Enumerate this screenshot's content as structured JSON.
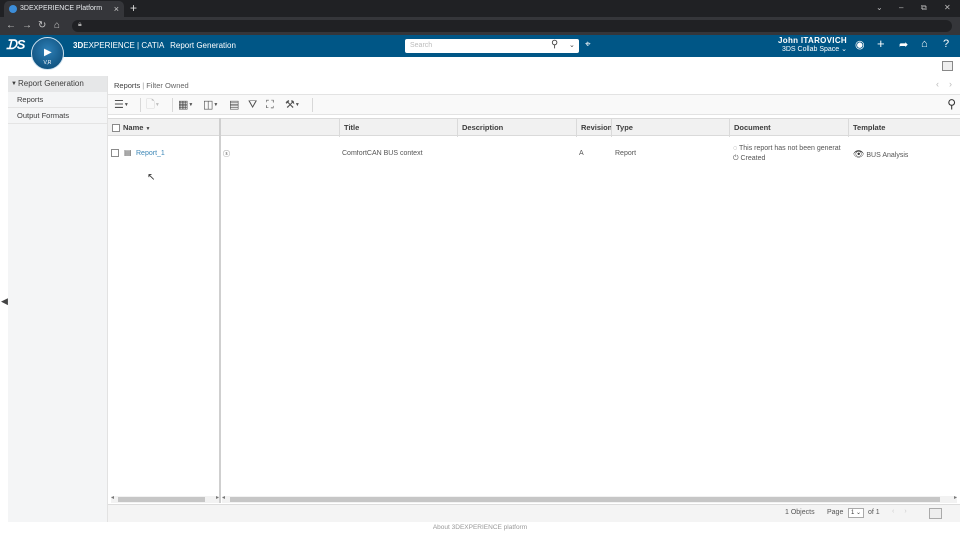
{
  "browser": {
    "tab_title": "3DEXPERIENCE Platform",
    "tab_close": "×",
    "new_tab": "+",
    "controls": {
      "chevron": "⌄",
      "minimize": "–",
      "restore": "⧉",
      "close": "✕"
    },
    "nav": {
      "back": "←",
      "forward": "→",
      "reload": "↻",
      "home": "⌂"
    }
  },
  "app": {
    "brand_prefix": "3D",
    "brand_rest": "EXPERIENCE | CATIA",
    "app_name": "Report Generation",
    "compass_label": "V,R",
    "search_placeholder": "Search",
    "user_name": "John  ITAROVICH",
    "collab_space": "3DS Collab Space ⌄"
  },
  "sidebar": {
    "header": "Report Generation",
    "items": [
      {
        "label": "Reports"
      },
      {
        "label": "Output Formats"
      }
    ]
  },
  "main": {
    "breadcrumb": "Reports",
    "filter": "Filter Owned",
    "columns": {
      "name": "Name",
      "title": "Title",
      "description": "Description",
      "revision": "Revision",
      "type": "Type",
      "document": "Document",
      "template": "Template"
    },
    "rows": [
      {
        "name": "Report_1",
        "title": "ComfortCAN BUS context",
        "description": "",
        "revision": "A",
        "type": "Report",
        "document_status": "This report has not been generat",
        "document_state": "Created",
        "template": "BUS Analysis"
      }
    ],
    "footer": {
      "objects_count": "1 Objects",
      "page_label": "Page",
      "page_value": "1",
      "of_label": "of 1"
    }
  },
  "about_link": "About 3DEXPERIENCE platform",
  "colors": {
    "header_bg": "#005686",
    "link": "#3b86b6",
    "browser_bg": "#202124"
  }
}
